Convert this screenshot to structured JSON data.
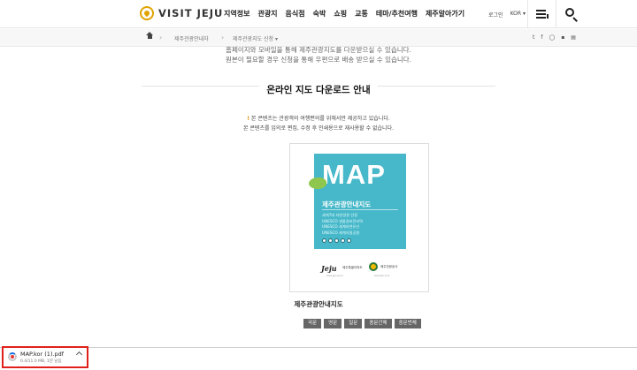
{
  "header": {
    "logo_text": "VISIT JEJU",
    "nav": [
      "지역정보",
      "관광지",
      "음식점",
      "숙박",
      "쇼핑",
      "교통",
      "테마/추천여행",
      "제주알아가기"
    ],
    "login": "로그인",
    "language": "KOR ▾"
  },
  "breadcrumb": {
    "items": [
      "제주관광안내자",
      "제주관광지도 신청 ▾"
    ]
  },
  "share": [
    "t",
    "f",
    "◯",
    "▪",
    "▤"
  ],
  "intro": {
    "line1": "홈페이지와 모바일을 통해 제주관광지도를 다운받으실 수 있습니다.",
    "line2": "원본이 필요할 경우 신청을 통해 우편으로 배송 받으실 수 있습니다."
  },
  "section": {
    "title": "온라인 지도 다운로드 안내"
  },
  "notice": {
    "mark": "!",
    "line1": " 본 콘텐츠는 관광객의 여행편의를 위해서만 제공하고 있습니다.",
    "line2": "본 콘텐츠를 임의로 편집, 수정 후 인쇄용으로 재사용할 수 없습니다."
  },
  "cover": {
    "big": "MAP",
    "title": "제주관광안내지도",
    "lines": [
      "세계7대 자연경관 선정",
      "UNESCO 생물권보전지역",
      "UNESCO 세계자연유산",
      "UNESCO 세계지질공원"
    ],
    "logo1": "Jeju",
    "logo1_text": "제주특별자치도",
    "logo2_text": "제주관광공사",
    "url1": "www.jeju.go.kr",
    "url2": "www.ijto.or.kr",
    "accent": "#46b8c9"
  },
  "caption": "제주관광안내지도",
  "languages": [
    "국문",
    "영문",
    "일문",
    "중문간체",
    "중문번체"
  ],
  "download": {
    "file_name": "MAP.kor (1).pdf",
    "status": "0.4/11.0 MB, 1분 남음"
  }
}
